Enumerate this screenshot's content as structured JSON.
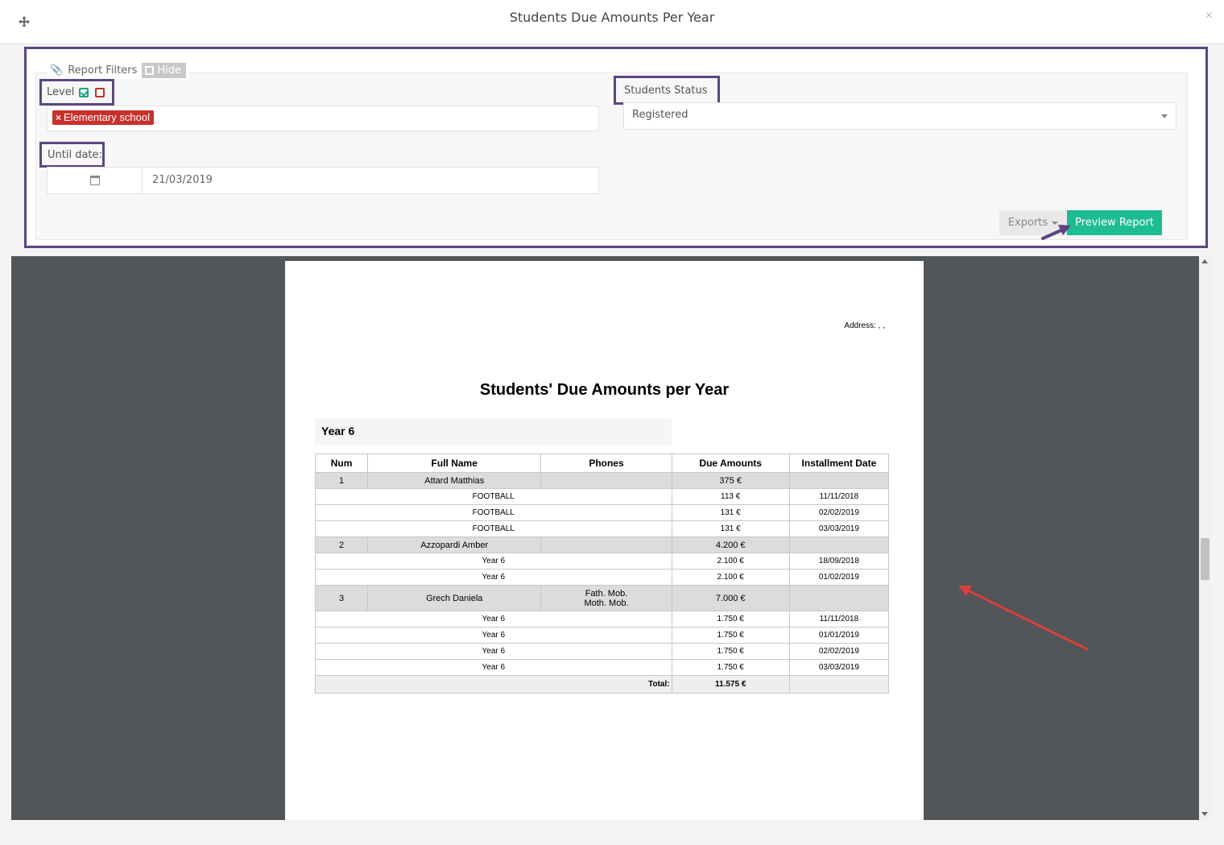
{
  "modal": {
    "title": "Students Due Amounts Per Year",
    "close": "×"
  },
  "filters": {
    "legend": "Report Filters",
    "hide_label": "Hide",
    "level": {
      "label": "Level",
      "tags": [
        "Elementary school"
      ]
    },
    "status": {
      "label": "Students Status",
      "value": "Registered"
    },
    "until": {
      "label": "Until date:",
      "value": "21/03/2019"
    },
    "exports_label": "Exports",
    "preview_label": "Preview Report"
  },
  "report": {
    "address": "Address: , ,",
    "title": "Students' Due Amounts per Year",
    "group": "Year 6",
    "columns": [
      "Num",
      "Full Name",
      "Phones",
      "Due Amounts",
      "Installment Date"
    ],
    "students": [
      {
        "num": "1",
        "name": "Attard Matthias",
        "phones": "",
        "amount": "375 €",
        "items": [
          {
            "desc": "FOOTBALL",
            "amount": "113 €",
            "date": "11/11/2018"
          },
          {
            "desc": "FOOTBALL",
            "amount": "131 €",
            "date": "02/02/2019"
          },
          {
            "desc": "FOOTBALL",
            "amount": "131 €",
            "date": "03/03/2019"
          }
        ]
      },
      {
        "num": "2",
        "name": "Azzopardi Amber",
        "phones": "",
        "amount": "4.200 €",
        "items": [
          {
            "desc": "Year 6",
            "amount": "2.100 €",
            "date": "18/09/2018"
          },
          {
            "desc": "Year 6",
            "amount": "2.100 €",
            "date": "01/02/2019"
          }
        ]
      },
      {
        "num": "3",
        "name": "Grech Daniela",
        "phones": [
          "Fath. Mob.",
          "Moth. Mob."
        ],
        "amount": "7.000 €",
        "items": [
          {
            "desc": "Year 6",
            "amount": "1.750 €",
            "date": "11/11/2018"
          },
          {
            "desc": "Year 6",
            "amount": "1.750 €",
            "date": "01/01/2019"
          },
          {
            "desc": "Year 6",
            "amount": "1.750 €",
            "date": "02/02/2019"
          },
          {
            "desc": "Year 6",
            "amount": "1.750 €",
            "date": "03/03/2019"
          }
        ]
      }
    ],
    "total_label": "Total:",
    "total_value": "11.575 €"
  },
  "colors": {
    "accent": "#1ebc93",
    "highlight_border": "#5c4581",
    "tag": "#c9302c",
    "annotation_arrow": "#d9413a"
  }
}
